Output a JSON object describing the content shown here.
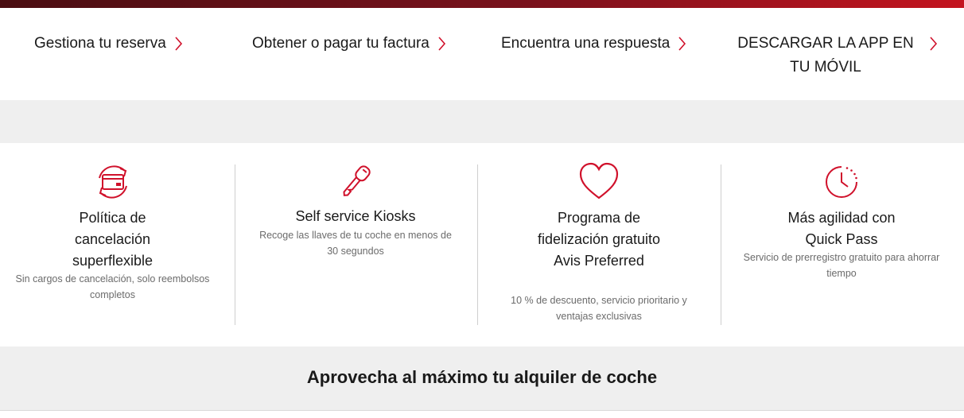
{
  "quick_links": [
    {
      "label": "Gestiona tu reserva",
      "icon": "chevron-right-icon"
    },
    {
      "label": "Obtener o pagar tu factura",
      "icon": "chevron-right-icon"
    },
    {
      "label": "Encuentra una respuesta",
      "icon": "chevron-right-icon"
    },
    {
      "label": "DESCARGAR LA APP EN TU MÓVIL",
      "icon": "chevron-right-icon"
    }
  ],
  "features": [
    {
      "icon": "refund-card-icon",
      "title": "Política de cancelación superflexible",
      "description": "Sin cargos de cancelación, solo reembolsos completos"
    },
    {
      "icon": "key-icon",
      "title": "Self service Kiosks",
      "description": "Recoge las llaves de tu coche en menos de 30 segundos"
    },
    {
      "icon": "heart-icon",
      "title": "Programa de fidelización gratuito Avis Preferred",
      "description": "10 % de descuento, servicio prioritario y ventajas exclusivas"
    },
    {
      "icon": "clock-icon",
      "title": "Más agilidad con Quick Pass",
      "description": "Servicio de prerregistro gratuito para ahorrar tiempo"
    }
  ],
  "bottom_heading": "Aprovecha al máximo tu alquiler de coche",
  "colors": {
    "accent": "#d0112b",
    "topbar_dark": "#4a0e12",
    "band": "#efefef"
  }
}
